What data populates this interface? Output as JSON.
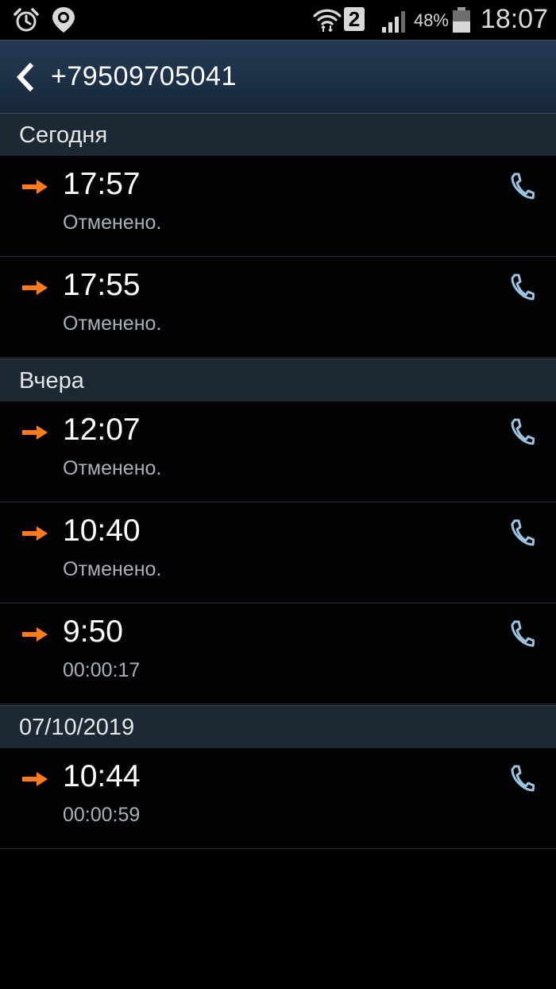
{
  "status_bar": {
    "left_icons": [
      "alarm-icon",
      "location-pin-icon"
    ],
    "right_icons": [
      "wifi-icon",
      "sim-2-icon",
      "signal-icon",
      "battery-icon"
    ],
    "sim_label": "2",
    "battery_percent": "48%",
    "time": "18:07"
  },
  "action_bar": {
    "back_icon": "back-arrow-icon",
    "title": "+79509705041"
  },
  "colors": {
    "arrow": "#ff7b1a",
    "phone": "#9cc3e0",
    "section_bg": "#1c2833",
    "action_bar": "#1e3249"
  },
  "sections": [
    {
      "header": "Сегодня",
      "calls": [
        {
          "time": "17:57",
          "detail": "Отменено."
        },
        {
          "time": "17:55",
          "detail": "Отменено."
        }
      ]
    },
    {
      "header": "Вчера",
      "calls": [
        {
          "time": "12:07",
          "detail": "Отменено."
        },
        {
          "time": "10:40",
          "detail": "Отменено."
        },
        {
          "time": "9:50",
          "detail": "00:00:17"
        }
      ]
    },
    {
      "header": "07/10/2019",
      "calls": [
        {
          "time": "10:44",
          "detail": "00:00:59"
        }
      ]
    }
  ]
}
